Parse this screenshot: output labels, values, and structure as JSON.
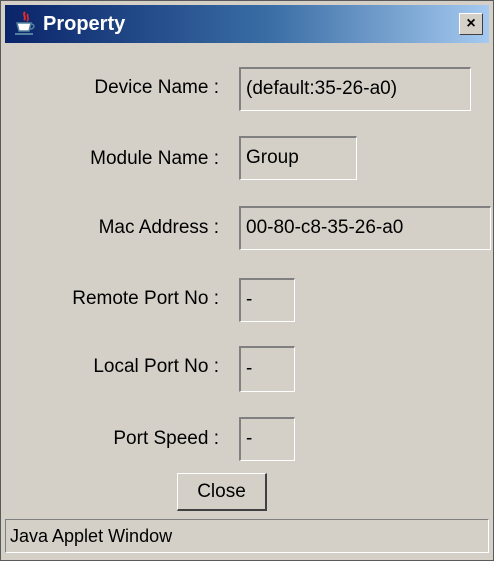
{
  "window": {
    "title": "Property",
    "title_icon": "java-cup-icon",
    "close_glyph": "×"
  },
  "form": {
    "fields": [
      {
        "label": "Device Name :",
        "value": "(default:35-26-a0)"
      },
      {
        "label": "Module Name :",
        "value": "Group"
      },
      {
        "label": "Mac Address :",
        "value": "00-80-c8-35-26-a0"
      },
      {
        "label": "Remote Port No :",
        "value": "-"
      },
      {
        "label": "Local Port No :",
        "value": "-"
      },
      {
        "label": "Port Speed :",
        "value": "-"
      }
    ]
  },
  "buttons": {
    "close_label": "Close"
  },
  "status": {
    "text": "Java Applet Window"
  },
  "colors": {
    "title_gradient_start": "#0a246a",
    "title_gradient_end": "#a6caf0",
    "window_bg": "#d4d0c8"
  }
}
